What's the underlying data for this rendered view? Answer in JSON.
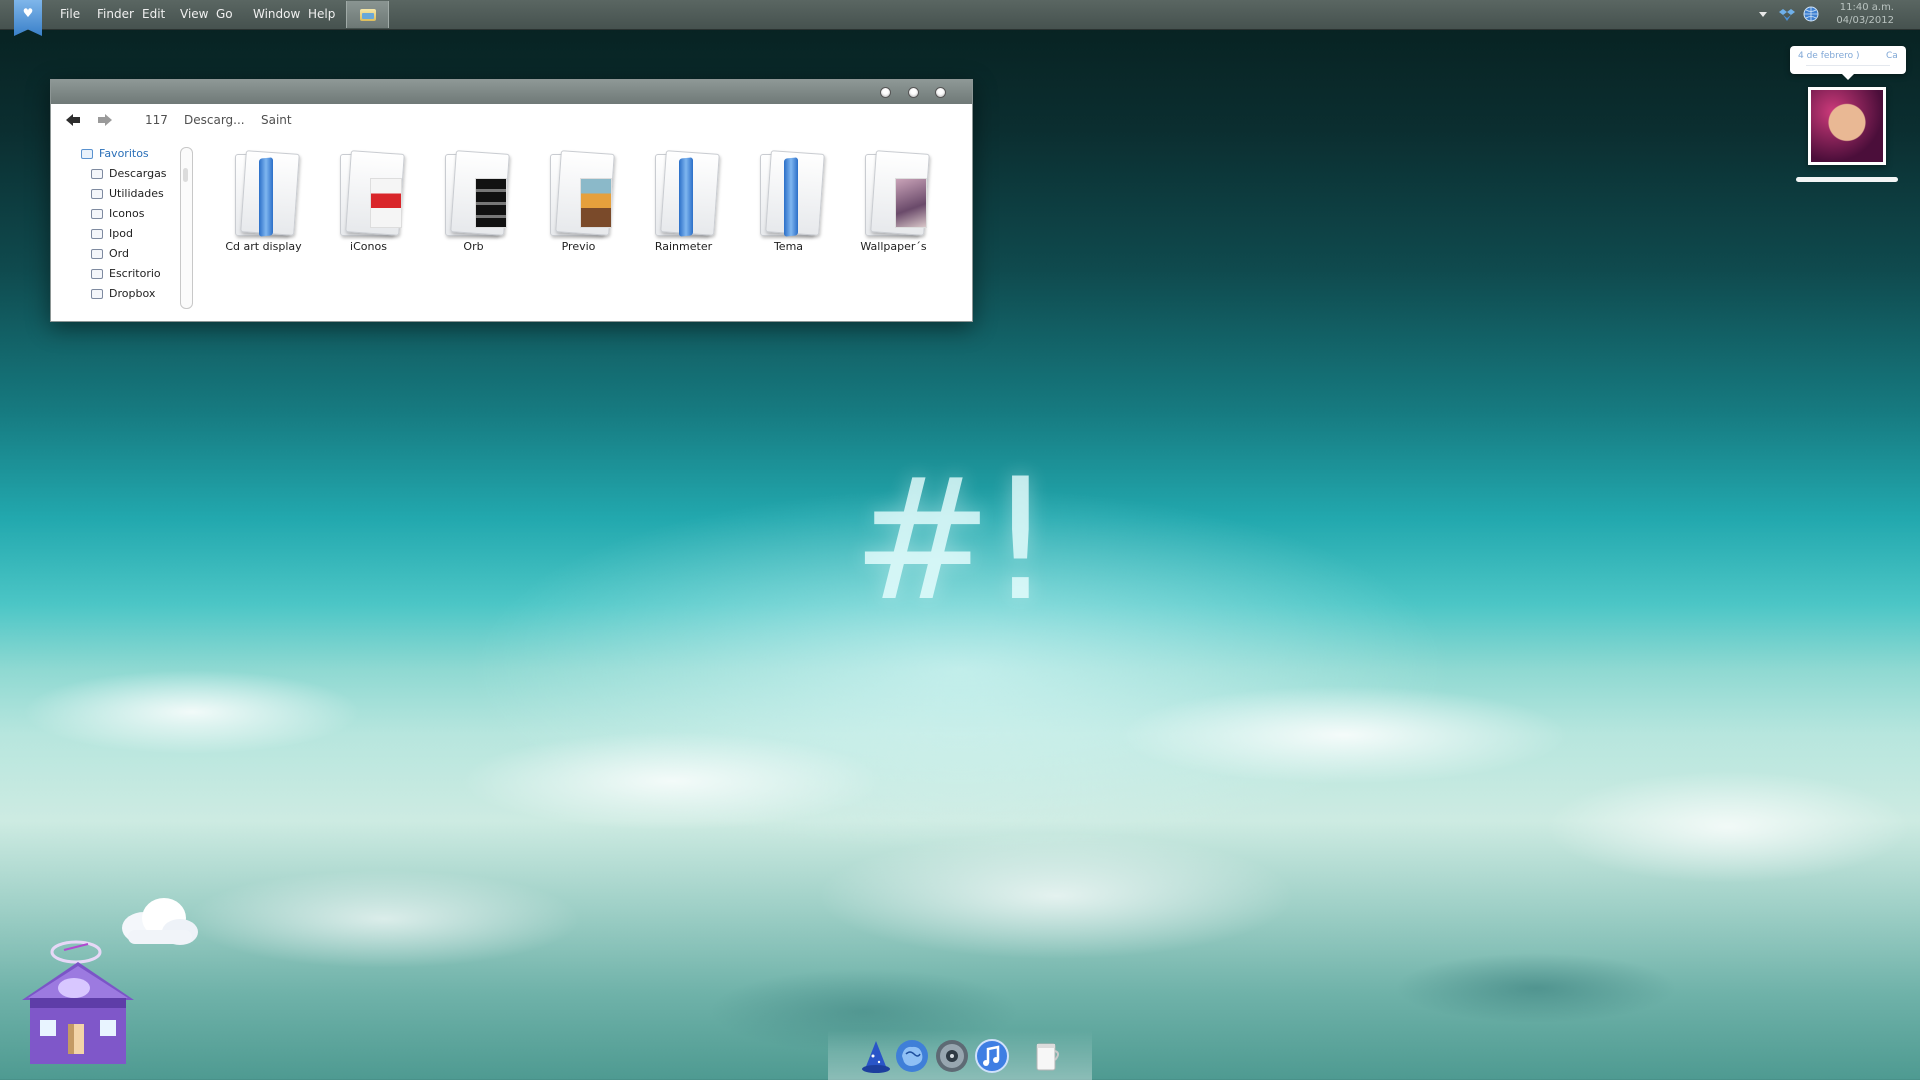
{
  "menubar": {
    "items": [
      "File",
      "Finder",
      "Edit",
      "View",
      "Go",
      "Window",
      "Help"
    ],
    "clock_time": "11:40 a.m.",
    "clock_date": "04/03/2012"
  },
  "window": {
    "toolbar": {
      "crumbs": [
        "117",
        "Descarg...",
        "Saint"
      ]
    },
    "sidebar": {
      "heading": "Favoritos",
      "items": [
        "Descargas",
        "Utilidades",
        "Iconos",
        "Ipod",
        "Ord",
        "Escritorio",
        "Dropbox"
      ]
    },
    "files": [
      {
        "label": "Cd art display",
        "icon": "folder-blue-icon"
      },
      {
        "label": "iConos",
        "icon": "folder-icons-icon"
      },
      {
        "label": "Orb",
        "icon": "folder-orb-icon"
      },
      {
        "label": "Previo",
        "icon": "folder-previo-icon"
      },
      {
        "label": "Rainmeter",
        "icon": "folder-blue-icon"
      },
      {
        "label": "Tema",
        "icon": "folder-blue-icon"
      },
      {
        "label": "Wallpaper´s",
        "icon": "folder-wallpaper-icon"
      }
    ]
  },
  "wallpaper": {
    "glyph": "#!"
  },
  "calendar_widget": {
    "date_text": "4 de febrero )",
    "more_text": "Ca"
  },
  "colors": {
    "accent": "#2a6fb8",
    "menubar": "#4f5b58"
  }
}
